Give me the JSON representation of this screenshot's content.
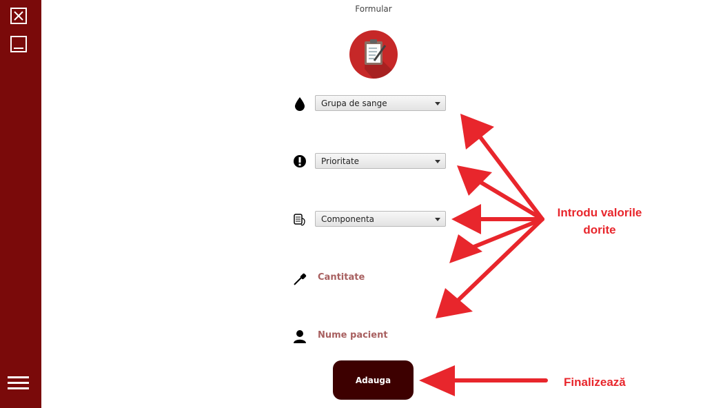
{
  "window": {
    "title": "Formular"
  },
  "form": {
    "blood_group": {
      "selected": "Grupa de sange"
    },
    "priority": {
      "selected": "Prioritate"
    },
    "component": {
      "selected": "Componenta"
    },
    "quantity": {
      "placeholder": "Cantitate"
    },
    "patient_name": {
      "placeholder": "Nume pacient"
    },
    "submit_label": "Adauga"
  },
  "annotations": {
    "enter_values": "Introdu valorile dorite",
    "finalize": "Finalizează"
  },
  "icons": {
    "sidebar": [
      "close-icon",
      "minimize-icon",
      "menu-icon"
    ],
    "form": [
      "blood-drop-icon",
      "exclamation-icon",
      "blood-bag-icon",
      "dropper-icon",
      "person-icon"
    ],
    "logo": "clipboard-icon"
  },
  "colors": {
    "sidebar": "#7a0a0a",
    "logo_bg": "#c62828",
    "button": "#3d0000",
    "label": "#a86060",
    "annotation": "#e8262c"
  }
}
